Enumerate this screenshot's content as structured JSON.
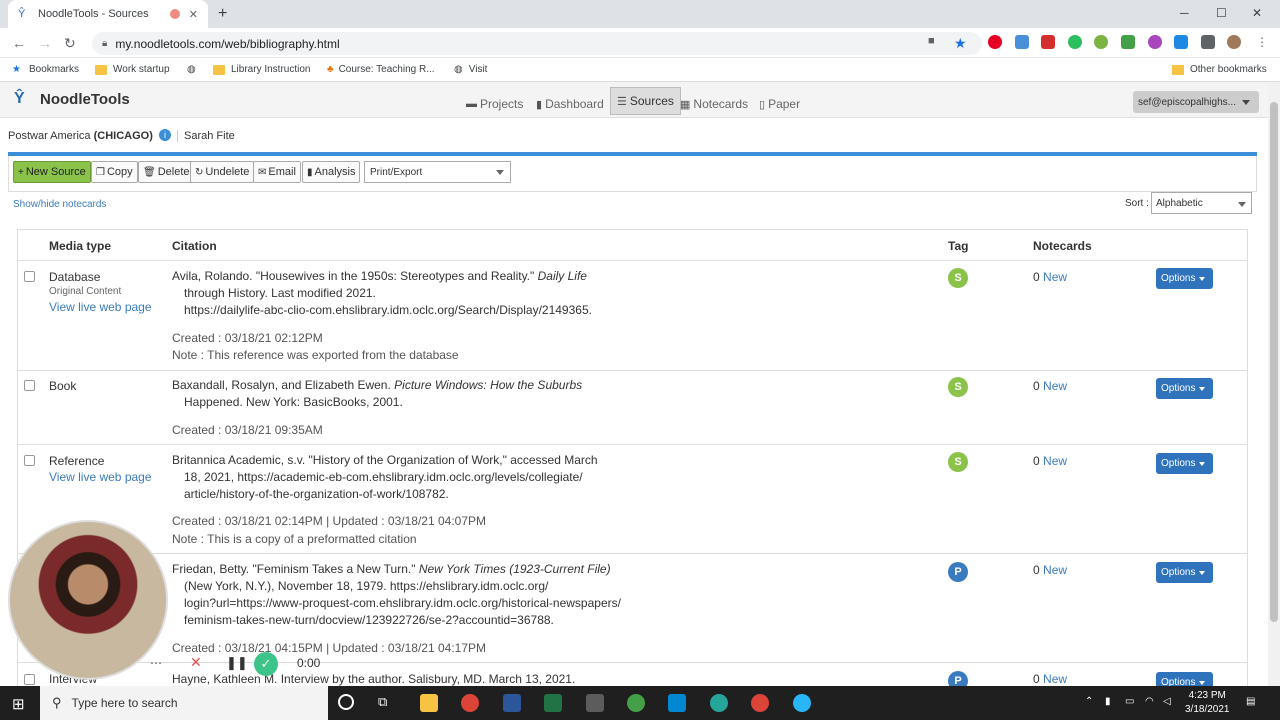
{
  "browser": {
    "tab_title": "NoodleTools - Sources",
    "url": "my.noodletools.com/web/bibliography.html",
    "bookmarks": [
      "Bookmarks",
      "Work startup",
      "Library Instruction",
      "Course: Teaching R...",
      "Visit",
      "Other bookmarks"
    ]
  },
  "app": {
    "logo": "NoodleTools",
    "nav": [
      "Projects",
      "Dashboard",
      "Sources",
      "Notecards",
      "Paper"
    ],
    "active_nav": "Sources",
    "user": "sef@episcopalhighs...",
    "project_name": "Postwar America",
    "project_style": "(CHICAGO)",
    "owner": "Sarah Fite"
  },
  "toolbar": {
    "new_source": "New Source",
    "copy": "Copy",
    "delete": "Delete",
    "undelete": "Undelete",
    "email": "Email",
    "analysis": "Analysis",
    "print_export": "Print/Export"
  },
  "list": {
    "show_hide": "Show/hide notecards",
    "sort_label": "Sort :",
    "sort_value": "Alphabetic",
    "headers": {
      "media": "Media type",
      "citation": "Citation",
      "tag": "Tag",
      "notecards": "Notecards"
    },
    "options_label": "Options",
    "new_label": "New",
    "rows": [
      {
        "media": "Database",
        "media_sub": "Original Content",
        "live_link": "View live web page",
        "cite_first": "Avila, Rolando. \"Housewives in the 1950s: Stereotypes and Reality.\"",
        "cite_first_italic": "Daily Life",
        "cite_lines": [
          "through History. Last modified 2021.",
          "https://dailylife-abc-clio-com.ehslibrary.idm.oclc.org/Search/Display/2149365."
        ],
        "created": "Created : 03/18/21 02:12PM",
        "note": "Note : This reference was exported from the database",
        "tag": "S",
        "notecards": "0"
      },
      {
        "media": "Book",
        "cite_first": "Baxandall, Rosalyn, and Elizabeth Ewen.",
        "cite_first_italic": "Picture Windows: How the Suburbs",
        "cite_lines": [
          "Happened. New York: BasicBooks, 2001."
        ],
        "created": "Created : 03/18/21 09:35AM",
        "tag": "S",
        "notecards": "0"
      },
      {
        "media": "Reference",
        "live_link": "View live web page",
        "cite_first": "Britannica Academic, s.v. \"History of the Organization of Work,\" accessed March",
        "cite_lines": [
          "18, 2021, https://academic-eb-com.ehslibrary.idm.oclc.org/levels/collegiate/",
          "article/history-of-the-organization-of-work/108782."
        ],
        "created": "Created : 03/18/21 02:14PM | Updated : 03/18/21 04:07PM",
        "note": "Note : This is a copy of a preformatted citation",
        "tag": "S",
        "notecards": "0"
      },
      {
        "media": "",
        "cite_first": "Friedan, Betty. \"Feminism Takes a New Turn.\"",
        "cite_first_italic": "New York Times (1923-Current File)",
        "cite_lines": [
          "(New York, N.Y.), November 18, 1979. https://ehslibrary.idm.oclc.org/",
          "login?url=https://www-proquest-com.ehslibrary.idm.oclc.org/historical-newspapers/",
          "feminism-takes-new-turn/docview/123922726/se-2?accountid=36788."
        ],
        "created": "Created : 03/18/21 04:15PM | Updated : 03/18/21 04:17PM",
        "tag": "P",
        "notecards": "0"
      },
      {
        "media": "Interview",
        "cite_first": "Hayne, Kathleen M. Interview by the author. Salisbury, MD. March 13, 2021.",
        "tag": "P",
        "notecards": "0"
      }
    ]
  },
  "recorder": {
    "time": "0:00"
  },
  "taskbar": {
    "search_placeholder": "Type here to search",
    "time": "4:23 PM",
    "date": "3/18/2021"
  }
}
